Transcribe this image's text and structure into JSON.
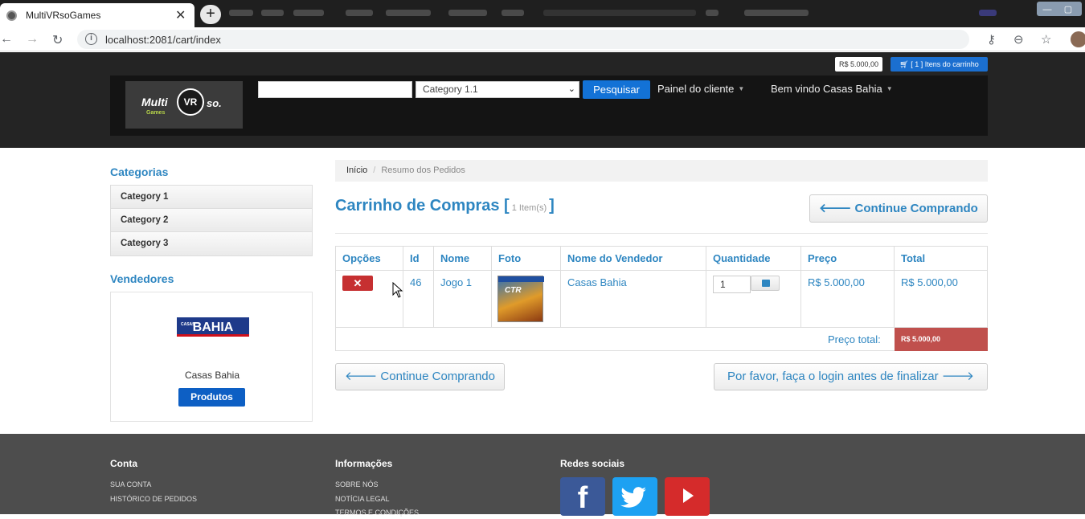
{
  "browser": {
    "tab_title": "MultiVRsoGames",
    "tab_close": "✕",
    "new_tab": "+",
    "url": "localhost:2081/cart/index"
  },
  "header": {
    "cart_total": "R$ 5.000,00",
    "cart_button": "[ 1 ] Itens do carrinho",
    "logo_multi": "Multi",
    "logo_vr": "VR",
    "logo_so": "so.",
    "logo_games": "Games",
    "search_placeholder": "",
    "category_selected": "Category 1.1",
    "search_button": "Pesquisar",
    "client_panel": "Painel do cliente",
    "welcome": "Bem vindo Casas Bahia"
  },
  "sidebar": {
    "categories_title": "Categorias",
    "categories": [
      "Category 1",
      "Category 2",
      "Category 3"
    ],
    "vendors_title": "Vendedores",
    "vendor_logo_small": "CASAS",
    "vendor_logo": "BAHIA",
    "vendor_name": "Casas Bahia",
    "vendor_button": "Produtos"
  },
  "breadcrumb": {
    "home": "Início",
    "separator": "/",
    "current": "Resumo dos Pedidos"
  },
  "cart": {
    "title": "Carrinho de Compras",
    "bracket_open": "[",
    "bracket_close": "]",
    "count_label": "1 Item(s)",
    "continue_top": "Continue Comprando",
    "columns": [
      "Opções",
      "Id",
      "Nome",
      "Foto",
      "Nome do Vendedor",
      "Quantidade",
      "Preço",
      "Total"
    ],
    "rows": [
      {
        "delete_label": "✕",
        "id": "46",
        "name": "Jogo 1",
        "cover_text": "CTR",
        "seller": "Casas Bahia",
        "quantity": "1",
        "price": "R$ 5.000,00",
        "total": "R$ 5.000,00"
      }
    ],
    "total_label": "Preço total:",
    "total_value": "R$ 5.000,00",
    "continue_bottom": "Continue Comprando",
    "login_button": "Por favor, faça o login antes de finalizar"
  },
  "footer": {
    "account_title": "Conta",
    "account_links": [
      "SUA CONTA",
      "HISTÓRICO DE PEDIDOS"
    ],
    "info_title": "Informações",
    "info_links": [
      "SOBRE NÓS",
      "NOTÍCIA LEGAL",
      "TERMOS E CONDIÇÕES"
    ],
    "social_title": "Redes sociais",
    "facebook_letter": "f"
  },
  "colors": {
    "accent_blue": "#2e86c1",
    "primary_button": "#1372d6",
    "danger": "#c63031",
    "total_badge": "#c0504d",
    "header_bg": "#242424",
    "footer_bg": "#4d4d4d"
  }
}
